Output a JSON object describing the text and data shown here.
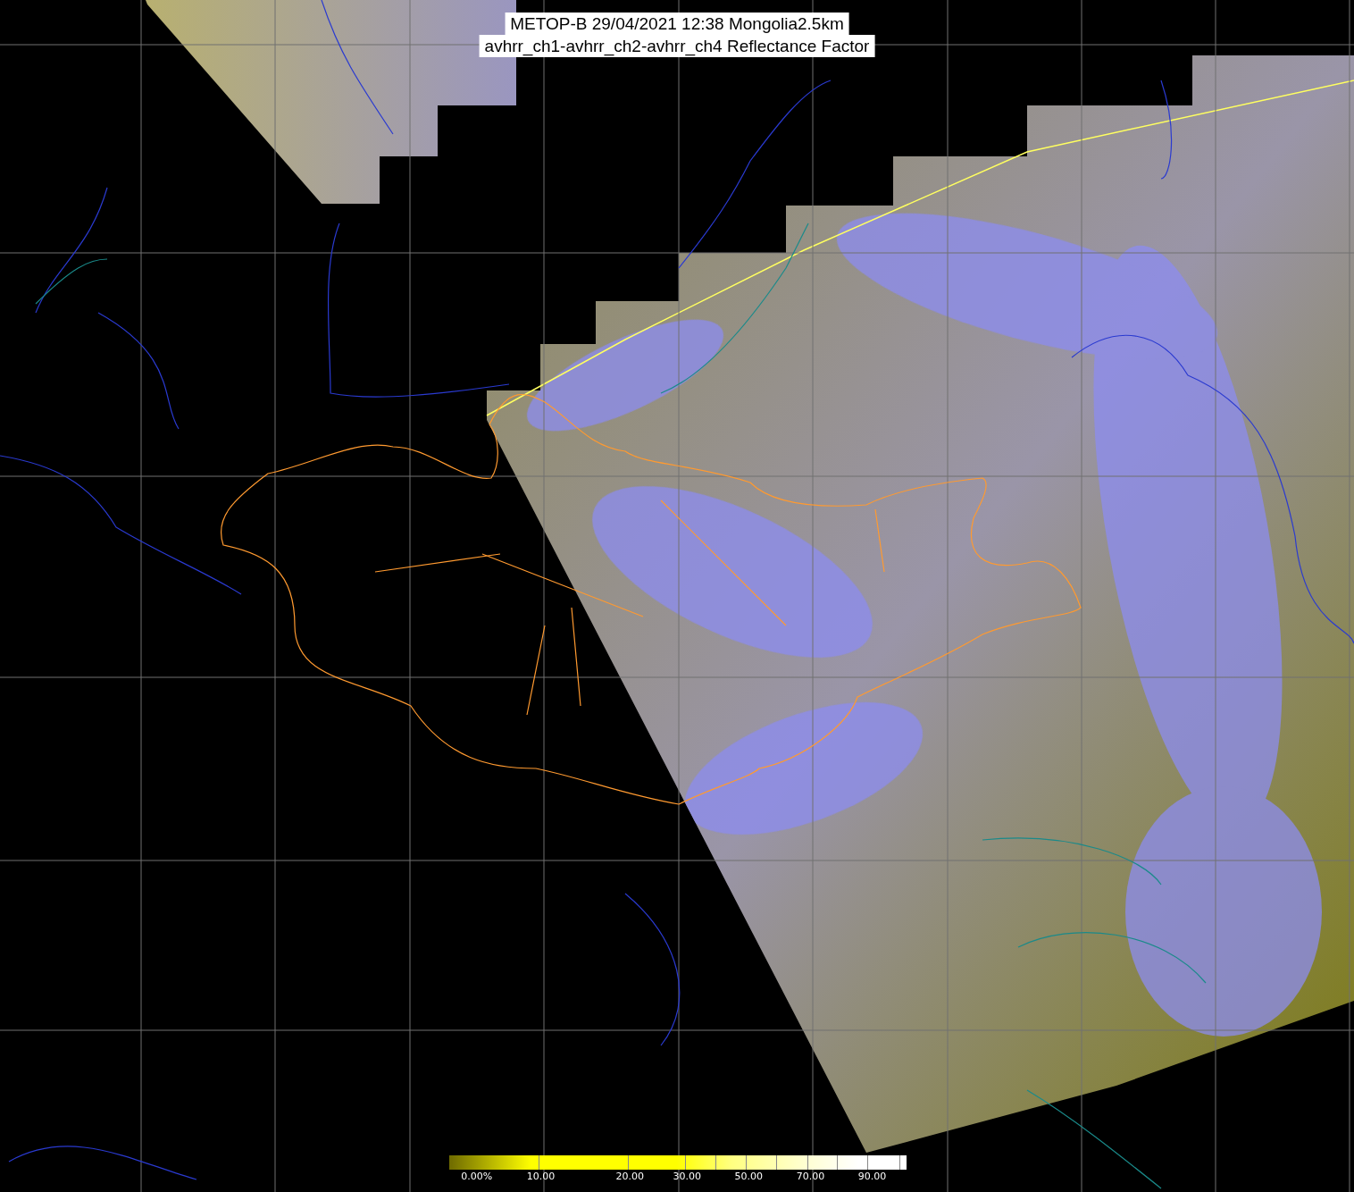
{
  "title": {
    "lines": [
      "METOP-B 29/04/2021 12:38 Mongolia2.5km",
      "avhrr_ch1-avhrr_ch2-avhrr_ch4 Reflectance Factor"
    ]
  },
  "color_scale": {
    "labels": [
      "0.00%",
      "10.00",
      "20.00",
      "30.00",
      "50.00",
      "70.00",
      "90.00"
    ]
  }
}
